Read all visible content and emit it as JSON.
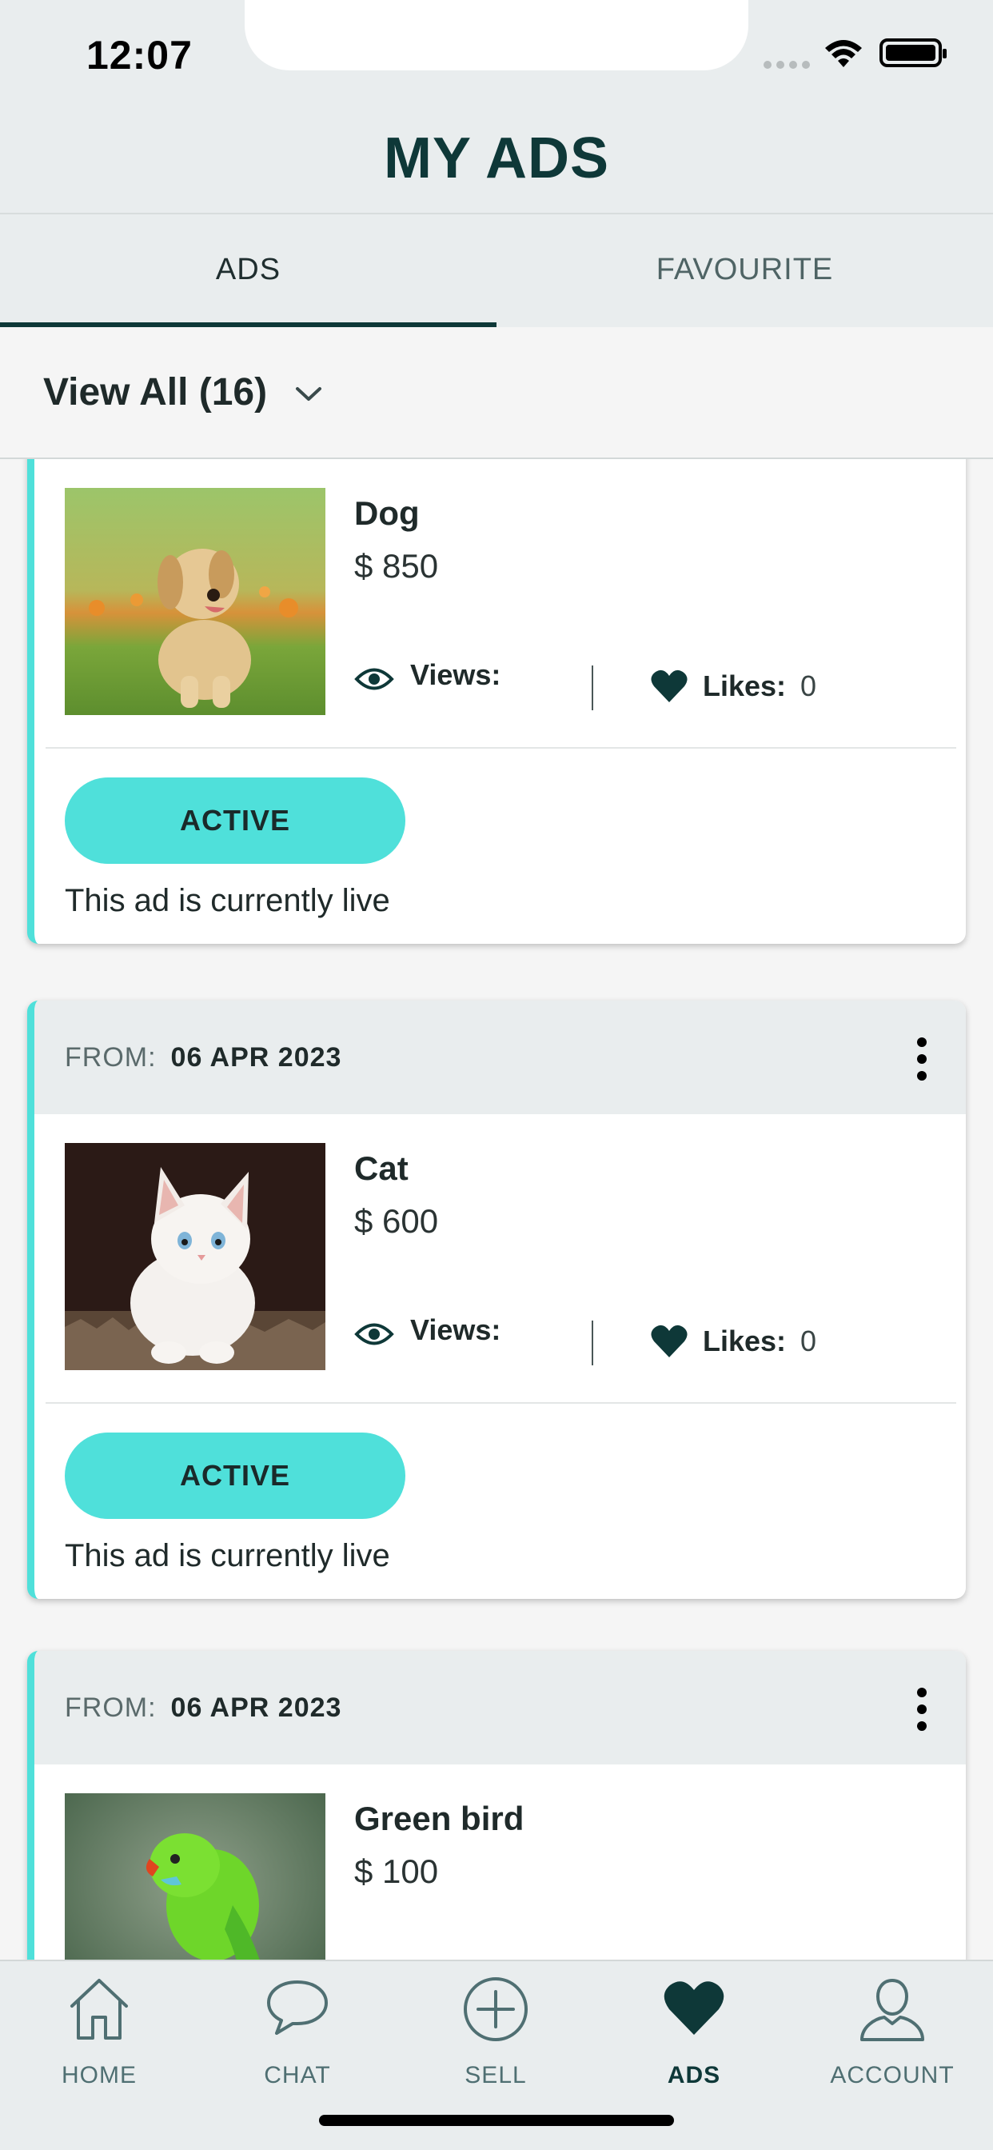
{
  "status_bar": {
    "time": "12:07"
  },
  "header": {
    "title": "MY ADS"
  },
  "tabs": [
    {
      "label": "ADS",
      "active": true
    },
    {
      "label": "FAVOURITE",
      "active": false
    }
  ],
  "filter": {
    "label": "View All (16)"
  },
  "ads": [
    {
      "title": "Dog",
      "price": "$ 850",
      "views_label": "Views:",
      "likes_label": "Likes:",
      "likes_value": "0",
      "status": "ACTIVE",
      "status_note": "This ad is currently live"
    },
    {
      "from_label": "FROM:",
      "from_date": "06 APR 2023",
      "title": "Cat",
      "price": "$ 600",
      "views_label": "Views:",
      "likes_label": "Likes:",
      "likes_value": "0",
      "status": "ACTIVE",
      "status_note": "This ad is currently live"
    },
    {
      "from_label": "FROM:",
      "from_date": "06 APR 2023",
      "title": "Green bird",
      "price": "$ 100"
    }
  ],
  "bottom_nav": [
    {
      "label": "HOME",
      "icon": "home-icon"
    },
    {
      "label": "CHAT",
      "icon": "chat-icon"
    },
    {
      "label": "SELL",
      "icon": "add-circle-icon"
    },
    {
      "label": "ADS",
      "icon": "heart-icon",
      "active": true
    },
    {
      "label": "ACCOUNT",
      "icon": "user-icon"
    }
  ],
  "colors": {
    "accent": "#4fe0da",
    "primary_dark": "#0e3838",
    "header_bg": "#e9edee",
    "nav_inactive": "#4f6f72"
  }
}
